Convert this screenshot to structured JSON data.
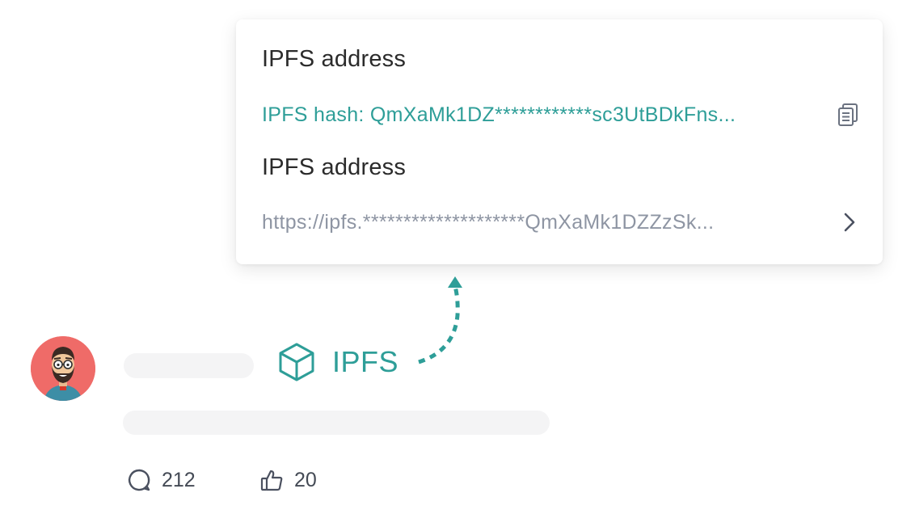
{
  "popover": {
    "hash_heading": "IPFS address",
    "hash_value": "IPFS hash: QmXaMk1DZ************sc3UtBDkFns...",
    "url_heading": "IPFS address",
    "url_value": "https://ipfs.********************QmXaMk1DZZzSk..."
  },
  "post": {
    "ipfs_label": "IPFS",
    "comment_count": "212",
    "like_count": "20"
  },
  "icons": {
    "copy": "copy-icon",
    "chevron": "chevron-right-icon",
    "cube": "cube-icon",
    "comment": "comment-icon",
    "like": "thumbs-up-icon"
  },
  "colors": {
    "accent_teal": "#2e9e98",
    "muted_text": "#8e95a3",
    "heading_text": "#2b2b2b",
    "avatar_bg": "#ef6b68",
    "skeleton": "#f4f4f5"
  }
}
